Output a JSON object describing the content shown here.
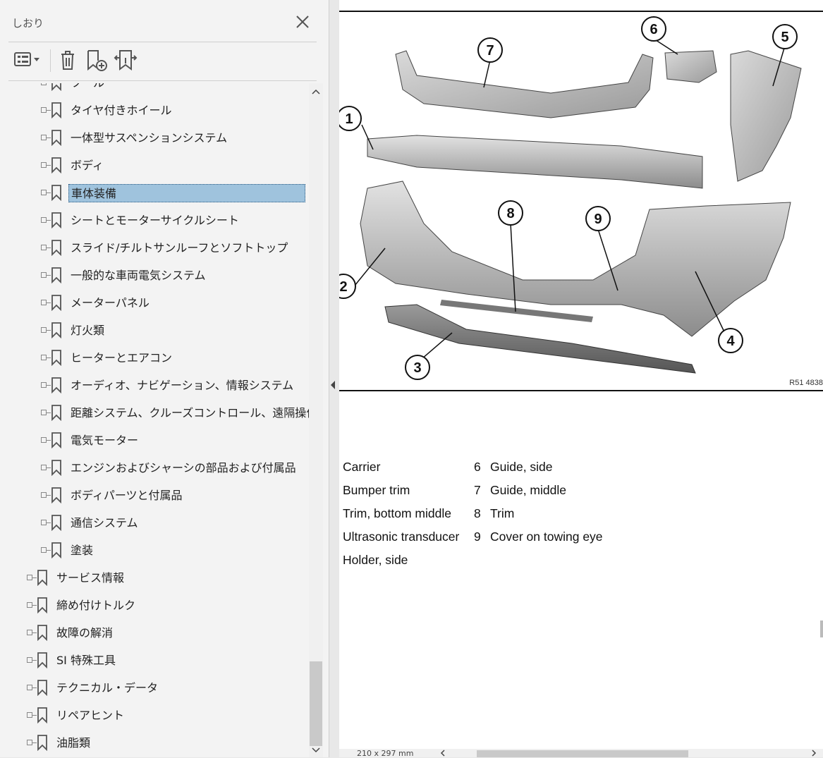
{
  "panel": {
    "title": "しおり",
    "tree": [
      {
        "label": "ツール",
        "level": 2
      },
      {
        "label": "タイヤ付きホイール",
        "level": 2
      },
      {
        "label": "一体型サスペンションシステム",
        "level": 2
      },
      {
        "label": "ボディ",
        "level": 2
      },
      {
        "label": "車体装備",
        "level": 2,
        "selected": true
      },
      {
        "label": "シートとモーターサイクルシート",
        "level": 2
      },
      {
        "label": "スライド/チルトサンルーフとソフトトップ",
        "level": 2
      },
      {
        "label": "一般的な車両電気システム",
        "level": 2
      },
      {
        "label": "メーターパネル",
        "level": 2
      },
      {
        "label": "灯火類",
        "level": 2
      },
      {
        "label": "ヒーターとエアコン",
        "level": 2
      },
      {
        "label": "オーディオ、ナビゲーション、情報システム",
        "level": 2
      },
      {
        "label": "距離システム、クルーズコントロール、遠隔操作",
        "level": 2
      },
      {
        "label": "電気モーター",
        "level": 2
      },
      {
        "label": "エンジンおよびシャーシの部品および付属品",
        "level": 2
      },
      {
        "label": "ボディパーツと付属品",
        "level": 2
      },
      {
        "label": "通信システム",
        "level": 2
      },
      {
        "label": "塗装",
        "level": 2
      },
      {
        "label": "サービス情報",
        "level": 1
      },
      {
        "label": "締め付けトルク",
        "level": 1
      },
      {
        "label": "故障の解消",
        "level": 1
      },
      {
        "label": "SI 特殊工具",
        "level": 1
      },
      {
        "label": "テクニカル・データ",
        "level": 1
      },
      {
        "label": "リペアヒント",
        "level": 1
      },
      {
        "label": "油脂類",
        "level": 1
      }
    ]
  },
  "document": {
    "figure_code": "R51 4838",
    "callouts": [
      "1",
      "2",
      "3",
      "4",
      "5",
      "6",
      "7",
      "8",
      "9"
    ],
    "legend_left": [
      "Carrier",
      "Bumper trim",
      "Trim, bottom middle",
      "Ultrasonic transducer",
      "Holder, side"
    ],
    "legend_right": [
      {
        "num": "6",
        "text": "Guide, side"
      },
      {
        "num": "7",
        "text": "Guide, middle"
      },
      {
        "num": "8",
        "text": "Trim"
      },
      {
        "num": "9",
        "text": "Cover on towing eye"
      }
    ],
    "page_size": "210 x 297 mm"
  }
}
